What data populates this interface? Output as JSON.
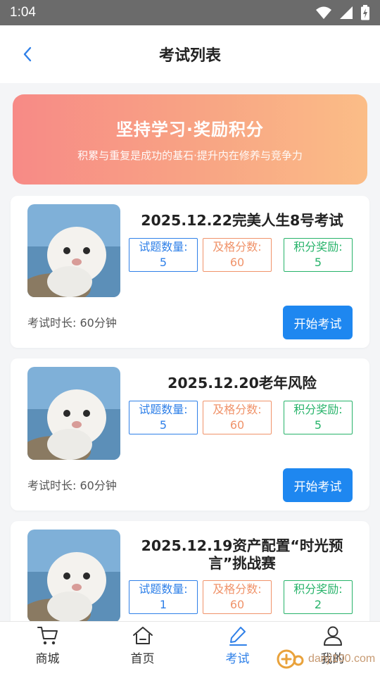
{
  "status_bar": {
    "time": "1:04"
  },
  "nav": {
    "title": "考试列表"
  },
  "banner": {
    "title": "坚持学习·奖励积分",
    "subtitle": "积累与重复是成功的基石·提升内在修养与竞争力"
  },
  "exams": [
    {
      "title_lines": [
        "2025.12.22完美人生8号考试"
      ],
      "question_count_label": "试题数量:",
      "question_count": "5",
      "pass_score_label": "及格分数:",
      "pass_score": "60",
      "reward_label": "积分奖励:",
      "reward": "5",
      "duration": "考试时长: 60分钟",
      "start_label": "开始考试"
    },
    {
      "title_lines": [
        "2025.12.20老年风险"
      ],
      "question_count_label": "试题数量:",
      "question_count": "5",
      "pass_score_label": "及格分数:",
      "pass_score": "60",
      "reward_label": "积分奖励:",
      "reward": "5",
      "duration": "考试时长: 60分钟",
      "start_label": "开始考试"
    },
    {
      "title_lines": [
        "2025.12.19资产配置“时光预",
        "言”挑战赛"
      ],
      "question_count_label": "试题数量:",
      "question_count": "1",
      "pass_score_label": "及格分数:",
      "pass_score": "60",
      "reward_label": "积分奖励:",
      "reward": "2"
    }
  ],
  "tabbar": {
    "items": [
      {
        "label": "商城",
        "icon": "cart-icon"
      },
      {
        "label": "首页",
        "icon": "home-icon"
      },
      {
        "label": "考试",
        "icon": "pencil-icon",
        "active": true
      },
      {
        "label": "我的",
        "icon": "user-icon"
      }
    ]
  },
  "watermark": {
    "text": "danji100.com"
  },
  "colors": {
    "accent": "#1e87f0",
    "blue": "#2f80e8",
    "orange": "#f0936a",
    "green": "#27b36a"
  }
}
